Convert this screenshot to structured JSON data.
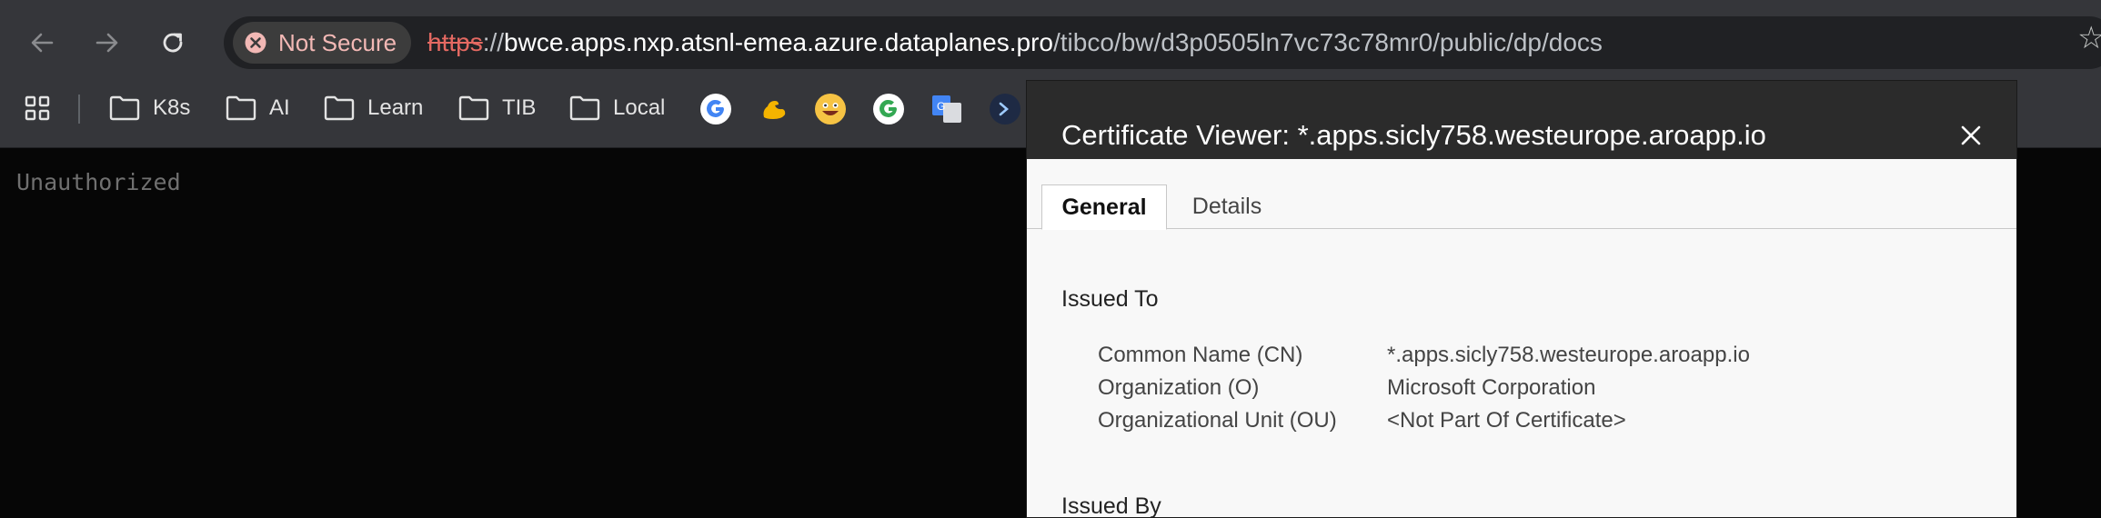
{
  "browser": {
    "security_chip": "Not Secure",
    "url_scheme": "https",
    "url_sep": "://",
    "url_host": "bwce.apps.nxp.atsnl-emea.azure.dataplanes.pro",
    "url_path": "/tibco/bw/d3p0505ln7vc73c78mr0/public/dp/docs",
    "bookmarks": [
      {
        "label": "K8s"
      },
      {
        "label": "AI"
      },
      {
        "label": "Learn"
      },
      {
        "label": "TIB"
      },
      {
        "label": "Local"
      }
    ]
  },
  "page": {
    "body_text": "Unauthorized"
  },
  "certificate_viewer": {
    "title": "Certificate Viewer: *.apps.sicly758.westeurope.aroapp.io",
    "tabs": [
      "General",
      "Details"
    ],
    "issued_to": {
      "heading": "Issued To",
      "rows": [
        {
          "label": "Common Name (CN)",
          "value": "*.apps.sicly758.westeurope.aroapp.io"
        },
        {
          "label": "Organization (O)",
          "value": "Microsoft Corporation"
        },
        {
          "label": "Organizational Unit (OU)",
          "value": "<Not Part Of Certificate>"
        }
      ]
    },
    "issued_by": {
      "heading": "Issued By"
    }
  },
  "colors": {
    "toolbar_bg": "#35363a",
    "warning_text": "#f2b8b5",
    "scheme_strike": "#e46962",
    "dialog_header": "#2b2b2b",
    "dialog_body": "#f8f8f8"
  }
}
